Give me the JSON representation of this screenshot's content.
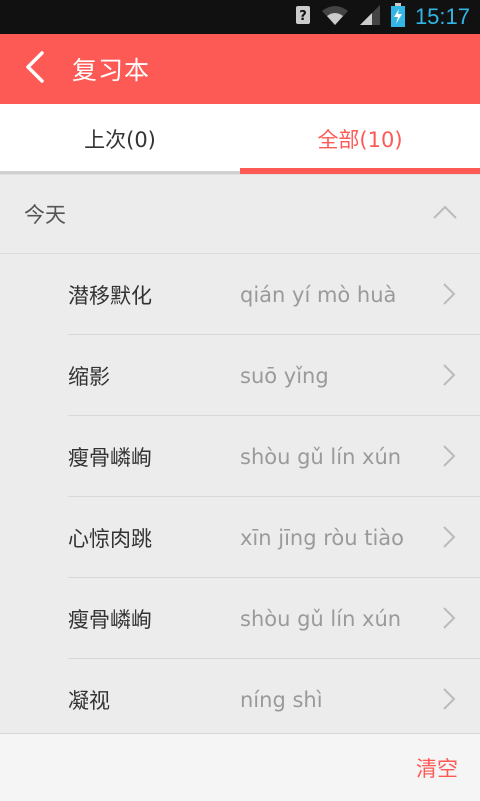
{
  "status_bar": {
    "time": "15:17",
    "icons": [
      "unknown-signal-icon",
      "wifi-icon",
      "cell-signal-icon",
      "battery-charging-icon"
    ]
  },
  "app_bar": {
    "title": "复习本",
    "back_icon": "chevron-left-icon"
  },
  "tabs": [
    {
      "label": "上次(0)",
      "active": false
    },
    {
      "label": "全部(10)",
      "active": true
    }
  ],
  "section": {
    "label": "今天",
    "collapse_icon": "chevron-up-icon"
  },
  "items": [
    {
      "word": "潜移默化",
      "pinyin": "qián yí mò huà"
    },
    {
      "word": "缩影",
      "pinyin": "suō yǐng"
    },
    {
      "word": "瘦骨嶙峋",
      "pinyin": "shòu gǔ lín xún"
    },
    {
      "word": "心惊肉跳",
      "pinyin": "xīn jīng ròu tiào"
    },
    {
      "word": "瘦骨嶙峋",
      "pinyin": "shòu gǔ lín xún"
    },
    {
      "word": "凝视",
      "pinyin": "níng shì"
    }
  ],
  "bottom_bar": {
    "clear_label": "清空"
  },
  "colors": {
    "accent": "#fd5a55",
    "status_blue": "#33b5e5"
  }
}
